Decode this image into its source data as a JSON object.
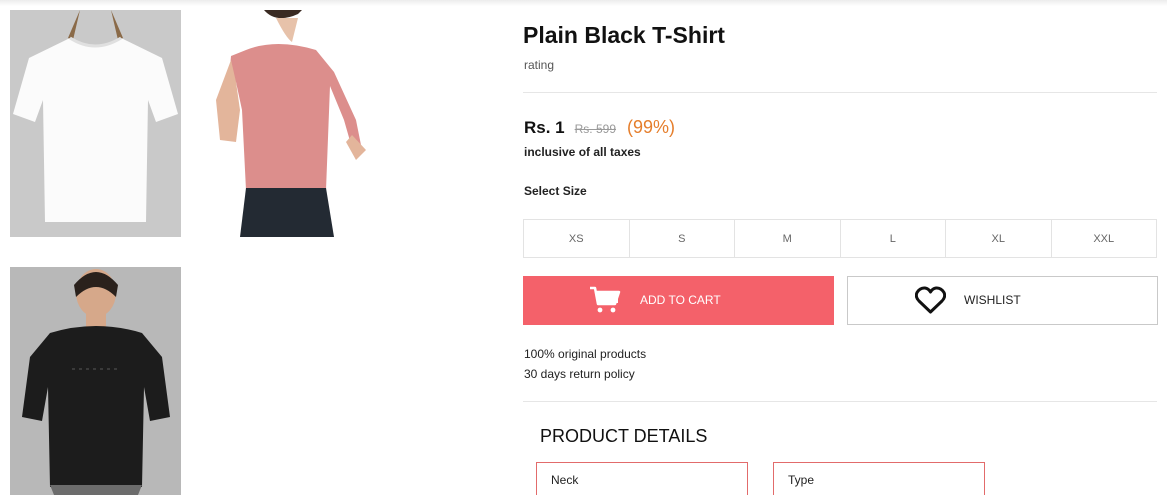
{
  "product": {
    "title": "Plain Black T-Shirt",
    "rating_label": "rating",
    "price": "Rs. 1",
    "mrp": "Rs. 599",
    "discount": "(99%)",
    "tax_note": "inclusive of all taxes"
  },
  "size_selector": {
    "label": "Select Size",
    "sizes": [
      "XS",
      "S",
      "M",
      "L",
      "XL",
      "XXL"
    ]
  },
  "actions": {
    "add_to_cart": "ADD TO CART",
    "wishlist": "WISHLIST"
  },
  "policies": [
    "100% original products",
    "30 days return policy"
  ],
  "product_details": {
    "heading": "PRODUCT DETAILS",
    "specs": [
      {
        "key": "Neck"
      },
      {
        "key": "Type"
      }
    ]
  },
  "gallery": [
    {
      "alt": "white t-shirt"
    },
    {
      "alt": "pink t-shirt worn by model"
    },
    {
      "alt": "black t-shirt worn by model"
    }
  ],
  "colors": {
    "accent": "#f4616a",
    "discount": "#e57e2c",
    "spec_border": "#e26b6b"
  }
}
